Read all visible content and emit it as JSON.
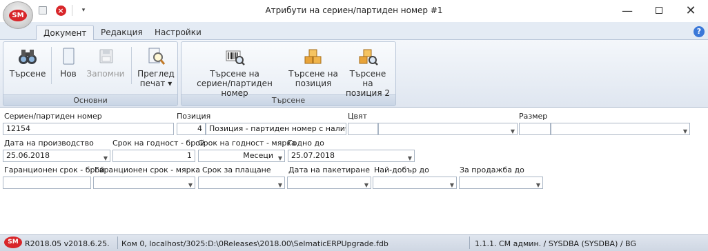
{
  "app": {
    "logo_text": "SM"
  },
  "window": {
    "title": "Атрибути на сериен/партиден номер #1"
  },
  "tabs": [
    {
      "label": "Документ",
      "active": true
    },
    {
      "label": "Редакция",
      "active": false
    },
    {
      "label": "Настройки",
      "active": false
    }
  ],
  "ribbon": {
    "osnovni": {
      "caption": "Основни",
      "search": "Търсене",
      "new": "Нов",
      "save": "Запомни",
      "preview_line1": "Преглед",
      "preview_line2": "печат ▾"
    },
    "tarsene": {
      "caption": "Търсене",
      "serial_line1": "Търсене на",
      "serial_line2": "сериен/партиден номер",
      "position_line1": "Търсене на",
      "position_line2": "позиция",
      "position2_line1": "Търсене на",
      "position2_line2": "позиция 2"
    }
  },
  "form": {
    "serial": {
      "label": "Сериен/партиден номер",
      "value": "12154"
    },
    "position": {
      "label": "Позиция",
      "number": "4",
      "value": "Позиция - партиден номер с наличн"
    },
    "color": {
      "label": "Цвят",
      "code": "",
      "value": ""
    },
    "size": {
      "label": "Размер",
      "code": "",
      "value": ""
    },
    "production_date": {
      "label": "Дата на производство",
      "value": "25.06.2018"
    },
    "shelf_life_count": {
      "label": "Срок на годност - брой",
      "value": "1"
    },
    "shelf_life_unit": {
      "label": "Срок на годност - мярка",
      "value": "Месеци"
    },
    "valid_until": {
      "label": "Годно до",
      "value": "25.07.2018"
    },
    "warranty_count": {
      "label": "Гаранционен срок - брой",
      "value": ""
    },
    "warranty_unit": {
      "label": "Гаранционен срок - мярка",
      "value": ""
    },
    "payment_term": {
      "label": "Срок за плащане",
      "value": ""
    },
    "packaging_date": {
      "label": "Дата на пакетиране",
      "value": ""
    },
    "best_before": {
      "label": "Най-добър до",
      "value": ""
    },
    "sell_by": {
      "label": "За продажба до",
      "value": ""
    }
  },
  "status": {
    "version": "R2018.05 v2018.6.25.",
    "connection": "Ком 0, localhost/3025:D:\\0Releases\\2018.00\\SelmaticERPUpgrade.fdb",
    "user": "1.1.1. CM админ. / SYSDBA (SYSDBA) / BG"
  },
  "colors": {
    "accent": "#3b78d8",
    "brand_red": "#d8262a",
    "ribbon_bg": "#e4ebf4"
  }
}
